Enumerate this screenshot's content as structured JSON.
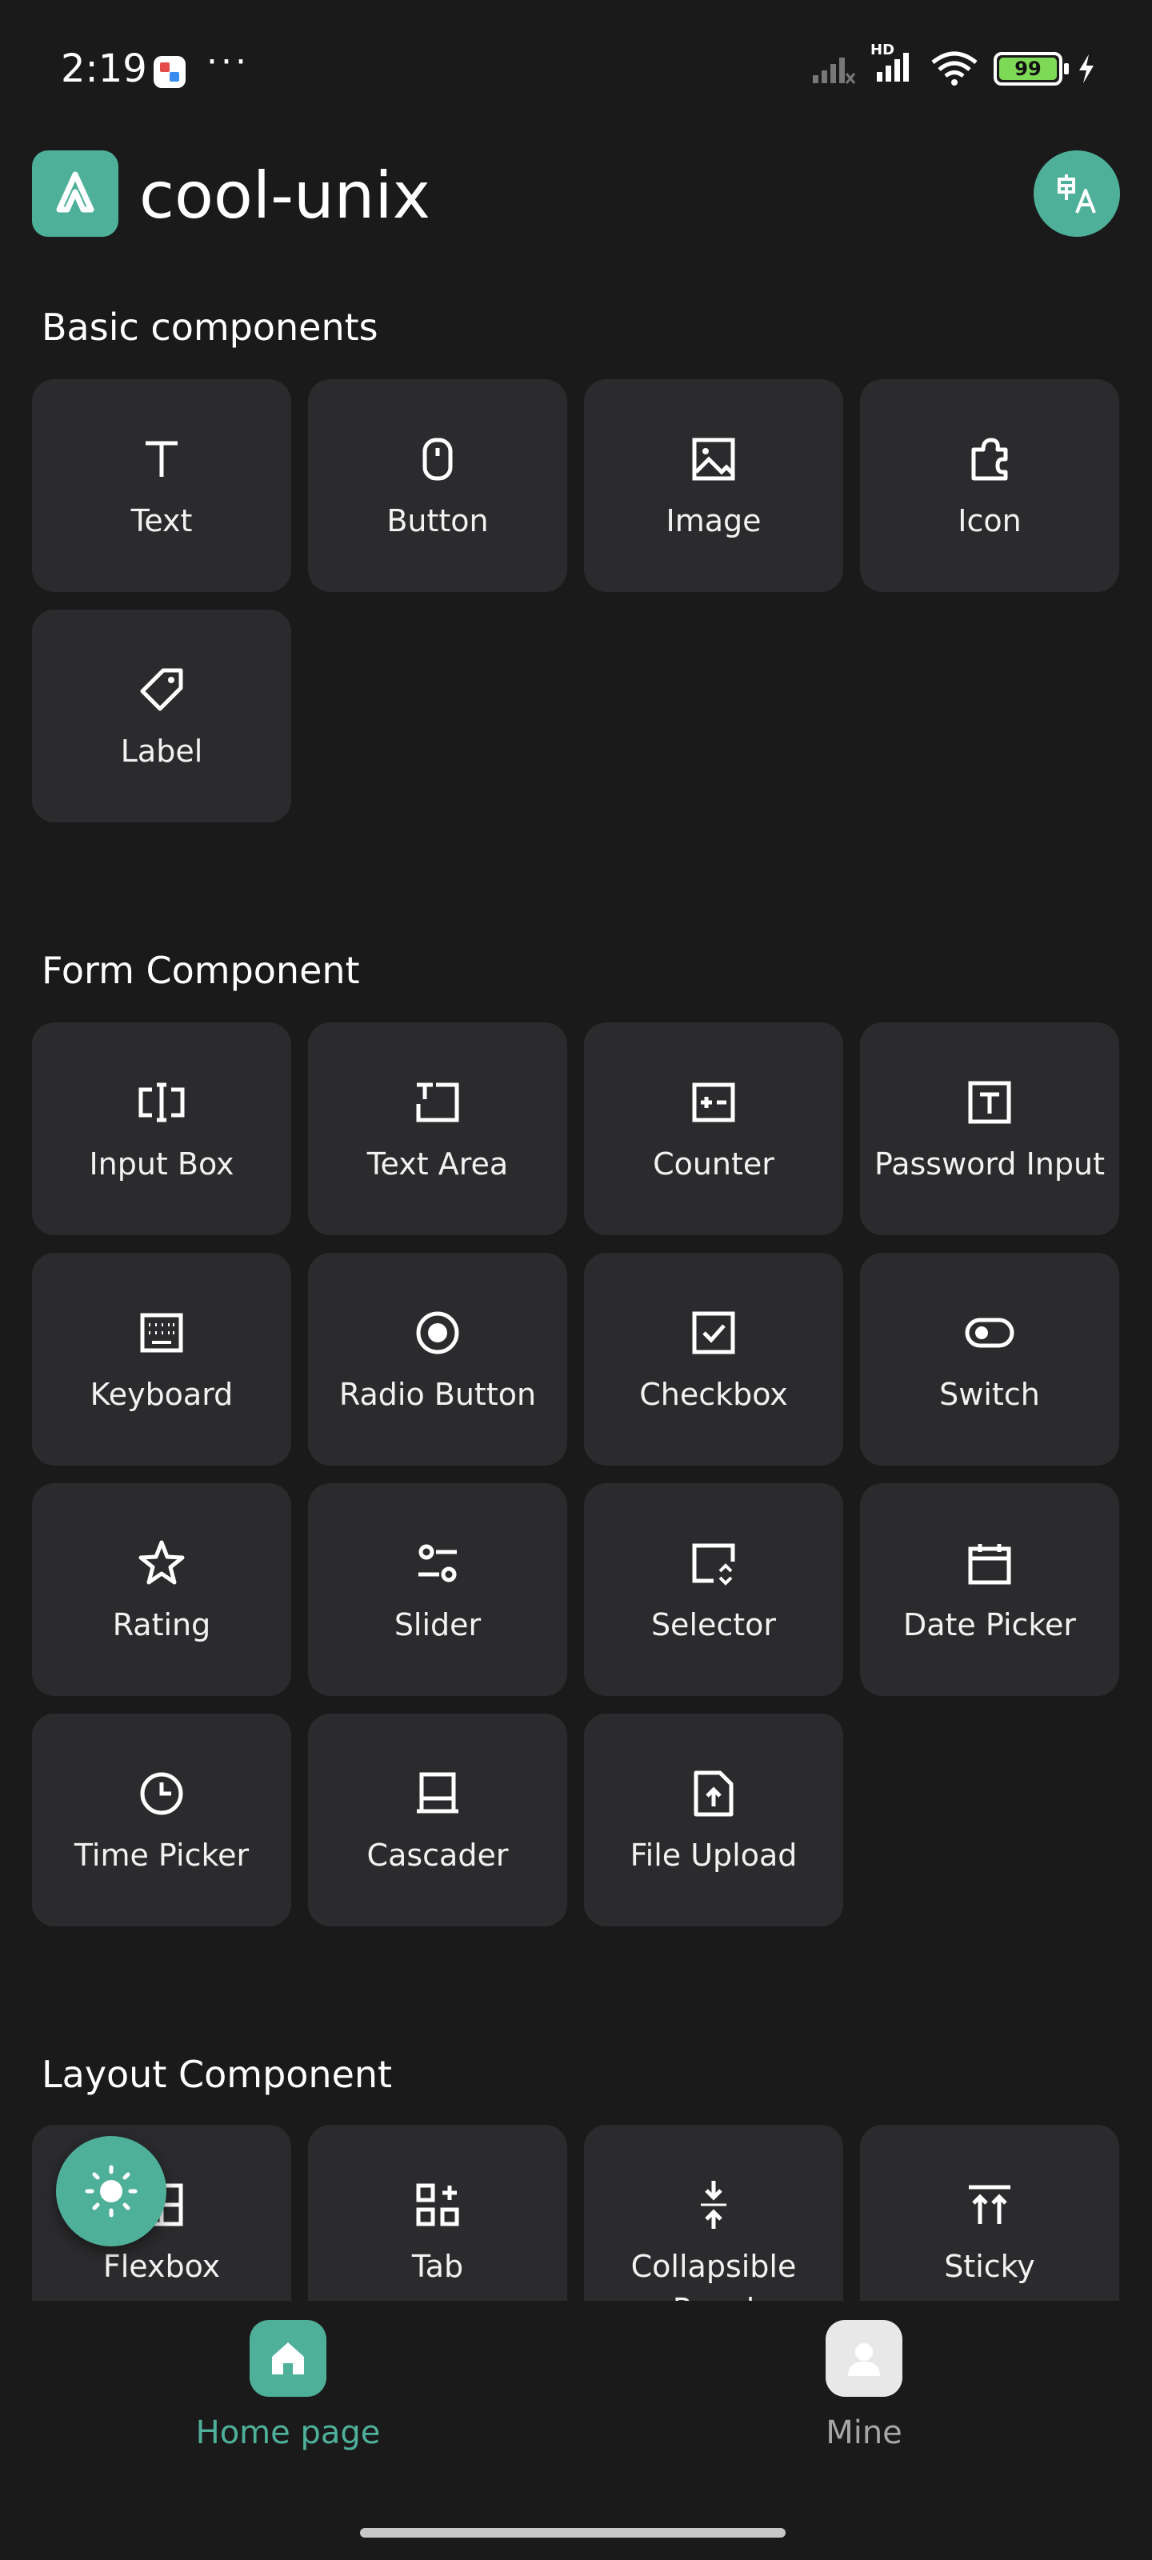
{
  "status_bar": {
    "time": "2:19",
    "more": "···",
    "network": "HD",
    "battery": "99"
  },
  "header": {
    "app_title": "cool-unix"
  },
  "colors": {
    "accent": "#4fb09a",
    "background": "#1a1a1b",
    "tile": "#2b2b2d",
    "inactive_text": "#a6a6a6"
  },
  "sections": {
    "basic": {
      "title": "Basic components",
      "items": [
        {
          "label": "Text",
          "icon": "text-icon"
        },
        {
          "label": "Button",
          "icon": "mouse-icon"
        },
        {
          "label": "Image",
          "icon": "image-icon"
        },
        {
          "label": "Icon",
          "icon": "puzzle-icon"
        },
        {
          "label": "Label",
          "icon": "tag-icon"
        }
      ]
    },
    "form": {
      "title": "Form Component",
      "items": [
        {
          "label": "Input Box",
          "icon": "input-cursor-icon"
        },
        {
          "label": "Text Area",
          "icon": "textarea-icon"
        },
        {
          "label": "Counter",
          "icon": "plus-minus-icon"
        },
        {
          "label": "Password Input",
          "icon": "text-box-icon"
        },
        {
          "label": "Keyboard",
          "icon": "keyboard-icon"
        },
        {
          "label": "Radio Button",
          "icon": "radio-icon"
        },
        {
          "label": "Checkbox",
          "icon": "checkbox-icon"
        },
        {
          "label": "Switch",
          "icon": "toggle-icon"
        },
        {
          "label": "Rating",
          "icon": "star-icon"
        },
        {
          "label": "Slider",
          "icon": "slider-icon"
        },
        {
          "label": "Selector",
          "icon": "selector-icon"
        },
        {
          "label": "Date Picker",
          "icon": "calendar-icon"
        },
        {
          "label": "Time Picker",
          "icon": "clock-icon"
        },
        {
          "label": "Cascader",
          "icon": "cascader-icon"
        },
        {
          "label": "File Upload",
          "icon": "file-upload-icon"
        }
      ]
    },
    "layout": {
      "title": "Layout Component",
      "items": [
        {
          "label": "Flexbox",
          "icon": "layout-icon"
        },
        {
          "label": "Tab",
          "icon": "apps-add-icon"
        },
        {
          "label": "Collapsible Panel",
          "icon": "collapse-icon"
        },
        {
          "label": "Sticky",
          "icon": "sticky-top-icon"
        }
      ]
    }
  },
  "tabbar": {
    "home_label": "Home page",
    "mine_label": "Mine"
  }
}
